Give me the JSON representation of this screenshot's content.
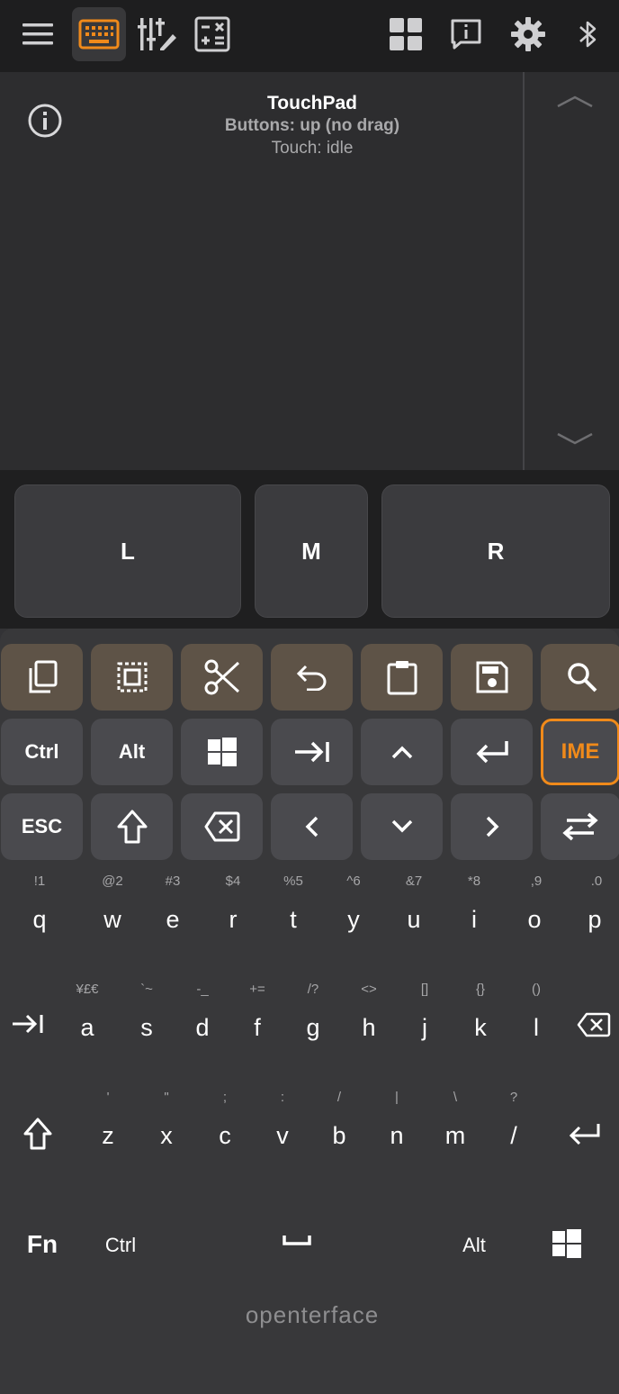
{
  "toolbar": {
    "icons": [
      "menu-icon",
      "keyboard-icon",
      "sliders-edit-icon",
      "calculator-icon",
      "layout-grid-icon",
      "info-bubble-icon",
      "settings-gear-icon",
      "bluetooth-icon"
    ],
    "active": "keyboard-icon"
  },
  "touchpad": {
    "title": "TouchPad",
    "buttons_status": "Buttons: up (no drag)",
    "touch_status": "Touch: idle"
  },
  "mouse_buttons": {
    "left": "L",
    "middle": "M",
    "right": "R"
  },
  "function_rows": {
    "row1_icons": [
      "copy-icon",
      "select-all-icon",
      "cut-icon",
      "undo-icon",
      "paste-icon",
      "save-icon",
      "search-icon"
    ],
    "row2": {
      "ctrl": "Ctrl",
      "alt": "Alt",
      "ime": "IME",
      "icons": [
        "windows-icon",
        "tab-icon",
        "arrow-up-icon",
        "enter-icon"
      ]
    },
    "row3": {
      "esc": "ESC",
      "icons": [
        "shift-icon",
        "delete-icon",
        "arrow-left-icon",
        "arrow-down-icon",
        "arrow-right-icon",
        "switch-icon"
      ]
    }
  },
  "qwerty": {
    "row1_hints": [
      "!1",
      "@2",
      "#3",
      "$4",
      "%5",
      "^6",
      "&7",
      "*8",
      ",9",
      ".0"
    ],
    "row1_keys": [
      "q",
      "w",
      "e",
      "r",
      "t",
      "y",
      "u",
      "i",
      "o",
      "p"
    ],
    "row2_hints": [
      "¥£€",
      "`~",
      "-_",
      "+=",
      "/?",
      "<>",
      "[]",
      "{}",
      "()"
    ],
    "row2_keys": [
      "a",
      "s",
      "d",
      "f",
      "g",
      "h",
      "j",
      "k",
      "l"
    ],
    "row3_hints": [
      "'",
      "\"",
      ";",
      ":",
      "/",
      "|",
      "\\",
      "?"
    ],
    "row3_keys": [
      "z",
      "x",
      "c",
      "v",
      "b",
      "n",
      "m",
      "/"
    ]
  },
  "bottom_row": {
    "fn": "Fn",
    "ctrl": "Ctrl",
    "alt": "Alt"
  },
  "brand": "openterface",
  "colors": {
    "accent": "#f08a1a",
    "toolbar_bg": "#1e1e1f",
    "keyboard_bg": "#38383a"
  }
}
